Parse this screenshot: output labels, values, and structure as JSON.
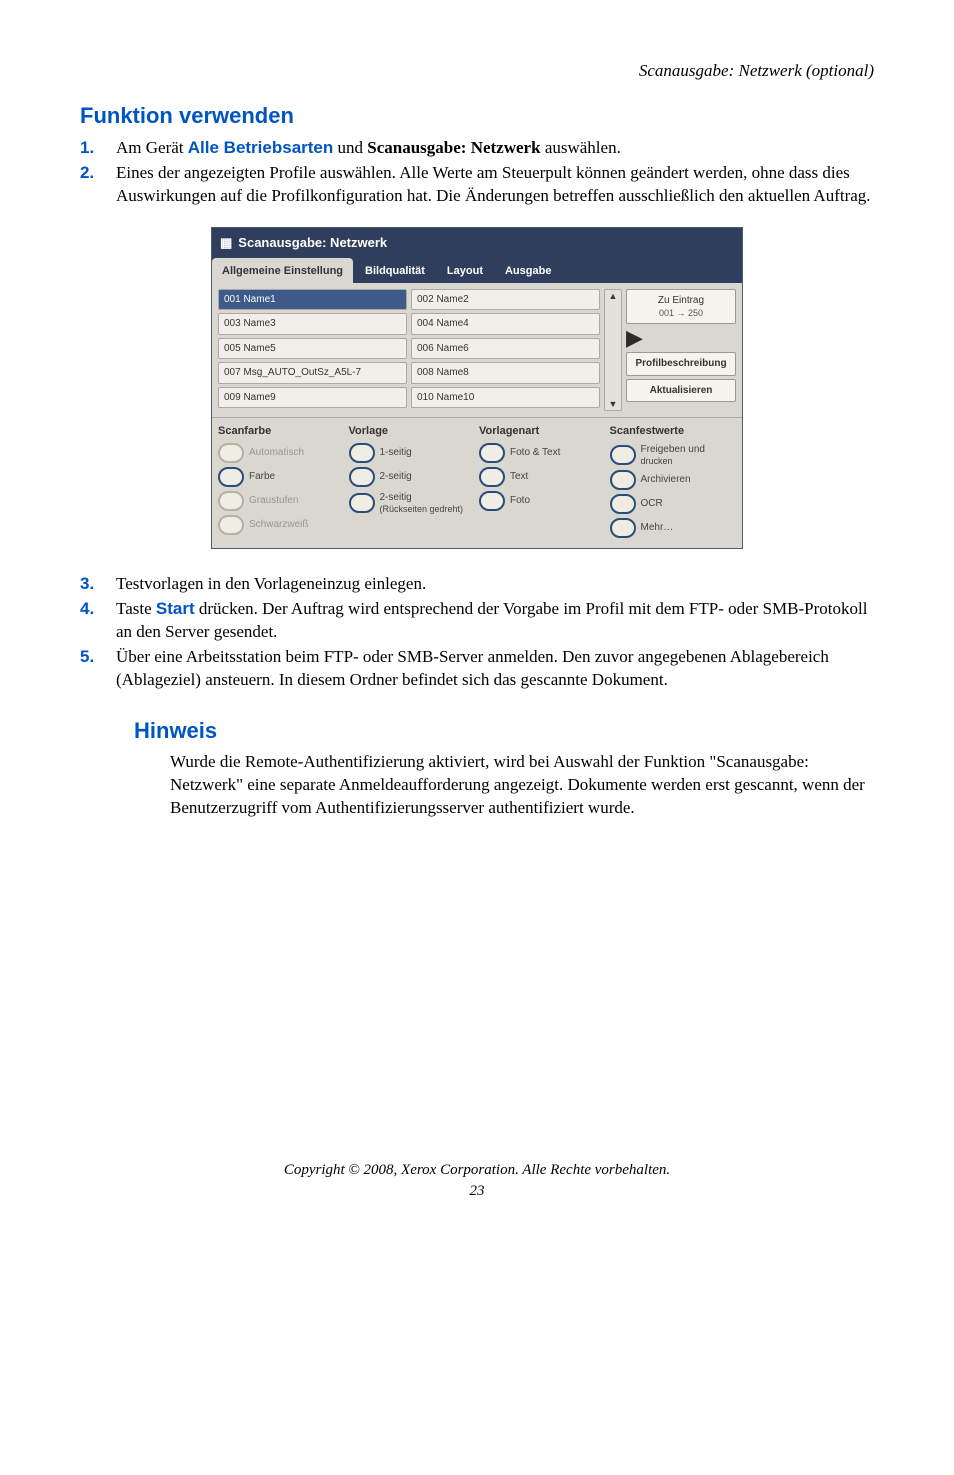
{
  "header_right": "Scanausgabe: Netzwerk (optional)",
  "h1": "Funktion verwenden",
  "steps": {
    "s1": {
      "marker": "1.",
      "pre": "Am Gerät ",
      "link": "Alle Betriebsarten",
      "mid": " und ",
      "bold": "Scanausgabe: Netzwerk",
      "post": " auswählen."
    },
    "s2": {
      "marker": "2.",
      "text": "Eines der angezeigten Profile auswählen. Alle Werte am Steuerpult können geändert werden, ohne dass dies Auswirkungen auf die Profilkonfiguration hat. Die Änderungen betreffen ausschließlich den aktuellen Auftrag."
    },
    "s3": {
      "marker": "3.",
      "text": "Testvorlagen in den Vorlageneinzug einlegen."
    },
    "s4": {
      "marker": "4.",
      "pre": "Taste ",
      "link": "Start",
      "post": " drücken. Der Auftrag wird entsprechend der Vorgabe im Profil mit dem FTP- oder SMB-Protokoll an den Server gesendet."
    },
    "s5": {
      "marker": "5.",
      "text": "Über eine Arbeitsstation beim FTP- oder SMB-Server anmelden. Den zuvor angegebenen Ablagebereich (Ablageziel) ansteuern. In diesem Ordner befindet sich das gescannte Dokument."
    }
  },
  "panel": {
    "title": "Scanausgabe: Netzwerk",
    "tabs": {
      "t0": "Allgemeine Einstellung",
      "t1": "Bildqualität",
      "t2": "Layout",
      "t3": "Ausgabe"
    },
    "rows": {
      "r0a": "001   Name1",
      "r0b": "002   Name2",
      "r1a": "003   Name3",
      "r1b": "004   Name4",
      "r2a": "005   Name5",
      "r2b": "006   Name6",
      "r3a": "007   Msg_AUTO_OutSz_A5L-7",
      "r3b": "008   Name8",
      "r4a": "009   Name9",
      "r4b": "010   Name10"
    },
    "scroll": {
      "up": "▲",
      "down": "▼"
    },
    "play": "▶",
    "side": {
      "b0": "Zu Eintrag",
      "b0sub": "001 → 250",
      "b1": "Profilbeschreibung",
      "b2": "Aktualisieren"
    },
    "cols": {
      "c0": {
        "title": "Scanfarbe",
        "o0": "Automatisch",
        "o1": "Farbe",
        "o2": "Graustufen",
        "o3": "Schwarzweiß"
      },
      "c1": {
        "title": "Vorlage",
        "o0": "1-seitig",
        "o1": "2-seitig",
        "o2a": "2-seitig",
        "o2b": "(Rückseiten gedreht)"
      },
      "c2": {
        "title": "Vorlagenart",
        "o0": "Foto & Text",
        "o1": "Text",
        "o2": "Foto"
      },
      "c3": {
        "title": "Scanfestwerte",
        "o0a": "Freigeben und",
        "o0b": "drucken",
        "o1": "Archivieren",
        "o2": "OCR",
        "o3": "Mehr…"
      }
    }
  },
  "hinweis": {
    "title": "Hinweis",
    "body": "Wurde die Remote-Authentifizierung aktiviert, wird bei Auswahl der Funktion \"Scanausgabe: Netzwerk\" eine separate Anmeldeaufforderung angezeigt. Dokumente werden erst gescannt, wenn der Benutzerzugriff vom Authentifizierungsserver authentifiziert wurde."
  },
  "footer": "Copyright © 2008, Xerox Corporation. Alle Rechte vorbehalten.",
  "pagenum": "23"
}
